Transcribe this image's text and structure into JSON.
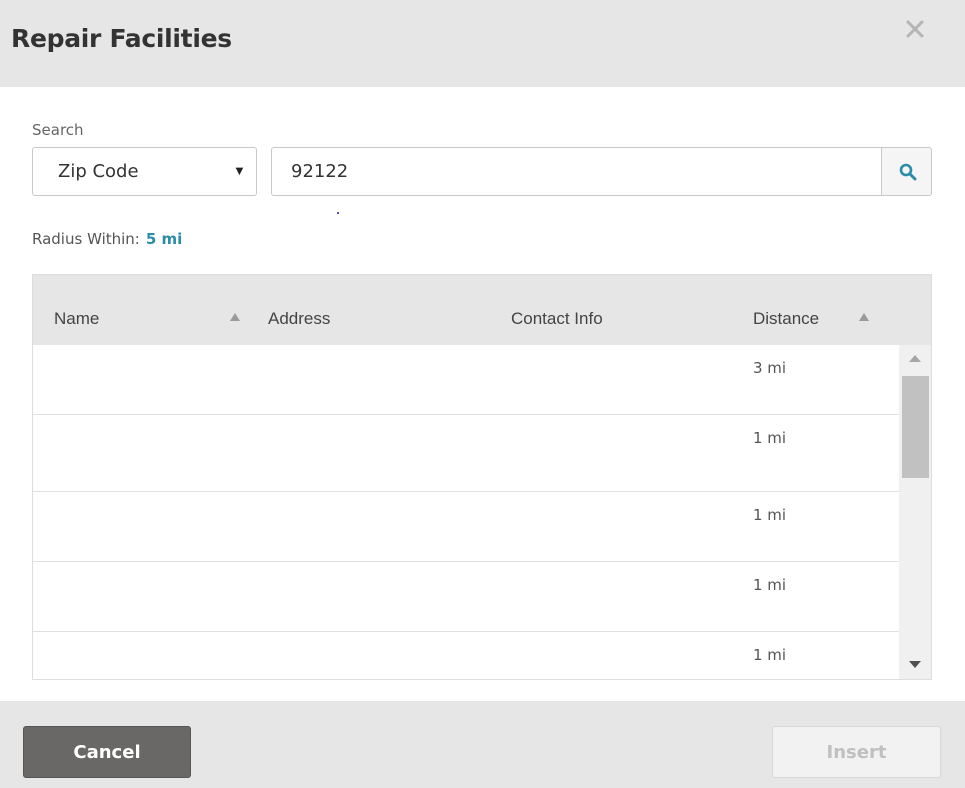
{
  "dialog": {
    "title": "Repair Facilities",
    "close_icon": "close-icon"
  },
  "search": {
    "label": "Search",
    "type_selected": "Zip Code",
    "zip_value": "92122",
    "search_icon": "search-icon"
  },
  "radius": {
    "label": "Radius Within:",
    "value": "5 mi"
  },
  "table": {
    "columns": [
      {
        "label": "Name",
        "sortable": true
      },
      {
        "label": "Address",
        "sortable": false
      },
      {
        "label": "Contact Info",
        "sortable": false
      },
      {
        "label": "Distance",
        "sortable": true
      }
    ],
    "rows": [
      {
        "name": "",
        "address": "",
        "contact": "",
        "distance": "3 mi"
      },
      {
        "name": "",
        "address": "",
        "contact": "",
        "distance": "1 mi"
      },
      {
        "name": "",
        "address": "",
        "contact": "",
        "distance": "1 mi"
      },
      {
        "name": "",
        "address": "",
        "contact": "",
        "distance": "1 mi"
      },
      {
        "name": "",
        "address": "",
        "contact": "",
        "distance": "1 mi"
      }
    ]
  },
  "footer": {
    "cancel_label": "Cancel",
    "insert_label": "Insert"
  },
  "colors": {
    "accent": "#2a8ca8",
    "header_bg": "#e6e6e6",
    "cancel_bg": "#6a6866"
  }
}
